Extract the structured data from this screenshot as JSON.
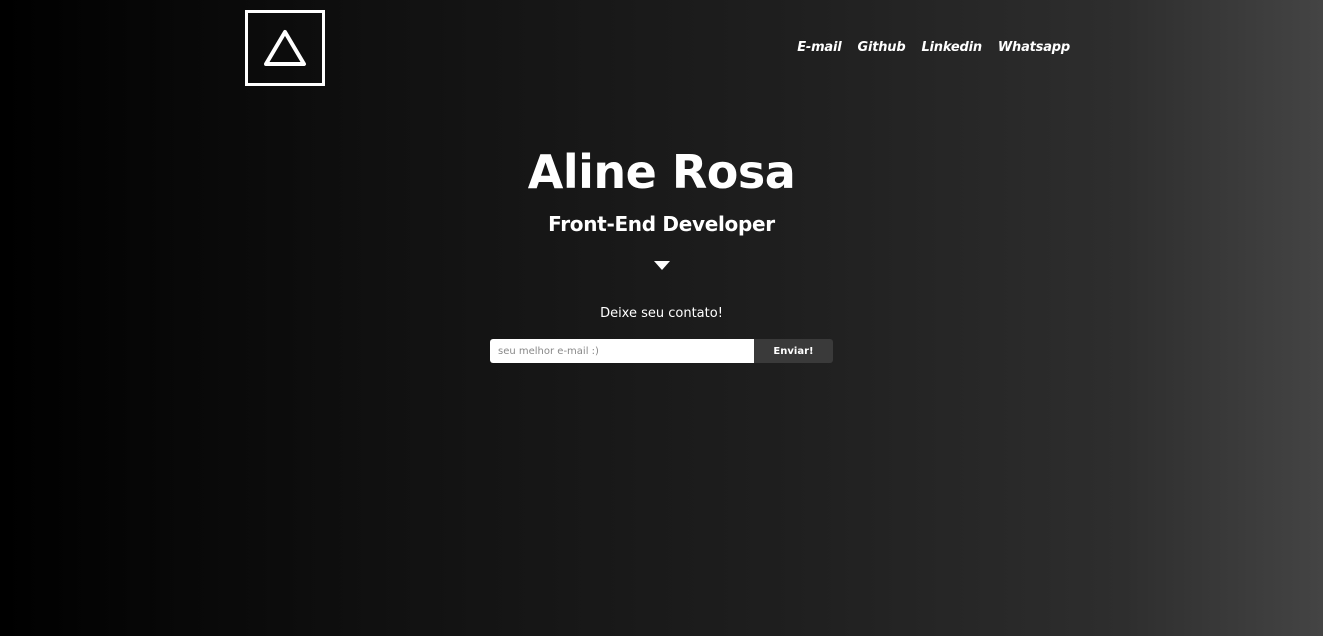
{
  "header": {
    "logo_icon": "triangle-outline-icon",
    "nav": [
      {
        "label": "E-mail"
      },
      {
        "label": "Github"
      },
      {
        "label": "Linkedin"
      },
      {
        "label": "Whatsapp"
      }
    ]
  },
  "hero": {
    "name": "Aline Rosa",
    "role": "Front-End Developer",
    "scroll_icon": "caret-down-icon"
  },
  "contact": {
    "label": "Deixe seu contato!",
    "email_placeholder": "seu melhor e-mail :)",
    "email_value": "",
    "submit_label": "Enviar!"
  },
  "colors": {
    "background_start": "#000000",
    "background_end": "#444444",
    "text": "#ffffff",
    "button_bg": "#3a3a3a"
  }
}
